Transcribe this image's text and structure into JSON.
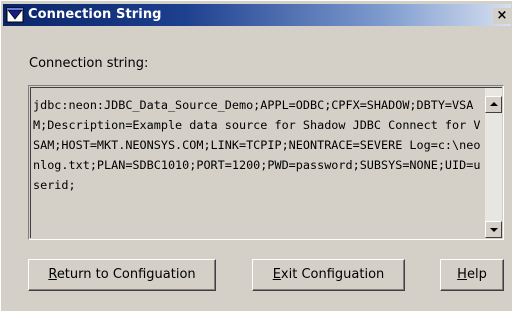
{
  "window": {
    "title": "Connection String",
    "close_label": "×"
  },
  "field": {
    "label": "Connection string:",
    "value": "jdbc:neon:JDBC_Data_Source_Demo;APPL=ODBC;CPFX=SHADOW;DBTY=VSAM;Description=Example data source for Shadow JDBC Connect for VSAM;HOST=MKT.NEONSYS.COM;LINK=TCPIP;NEONTRACE=SEVERE Log=c:\\neonlog.txt;PLAN=SDBC1010;PORT=1200;PWD=password;SUBSYS=NONE;UID=userid;"
  },
  "buttons": {
    "return": {
      "mnemonic": "R",
      "rest": "eturn to Configuation"
    },
    "exit": {
      "mnemonic": "E",
      "rest": "xit Configuation"
    },
    "help": {
      "mnemonic": "H",
      "rest": "elp"
    }
  },
  "colors": {
    "title_bar_start": "#0a246a",
    "title_bar_end": "#d6e0f0",
    "face": "#d4d0c8"
  },
  "icons": {
    "title": "window-app-icon",
    "scroll_up": "arrow-up-icon",
    "scroll_down": "arrow-down-icon"
  }
}
